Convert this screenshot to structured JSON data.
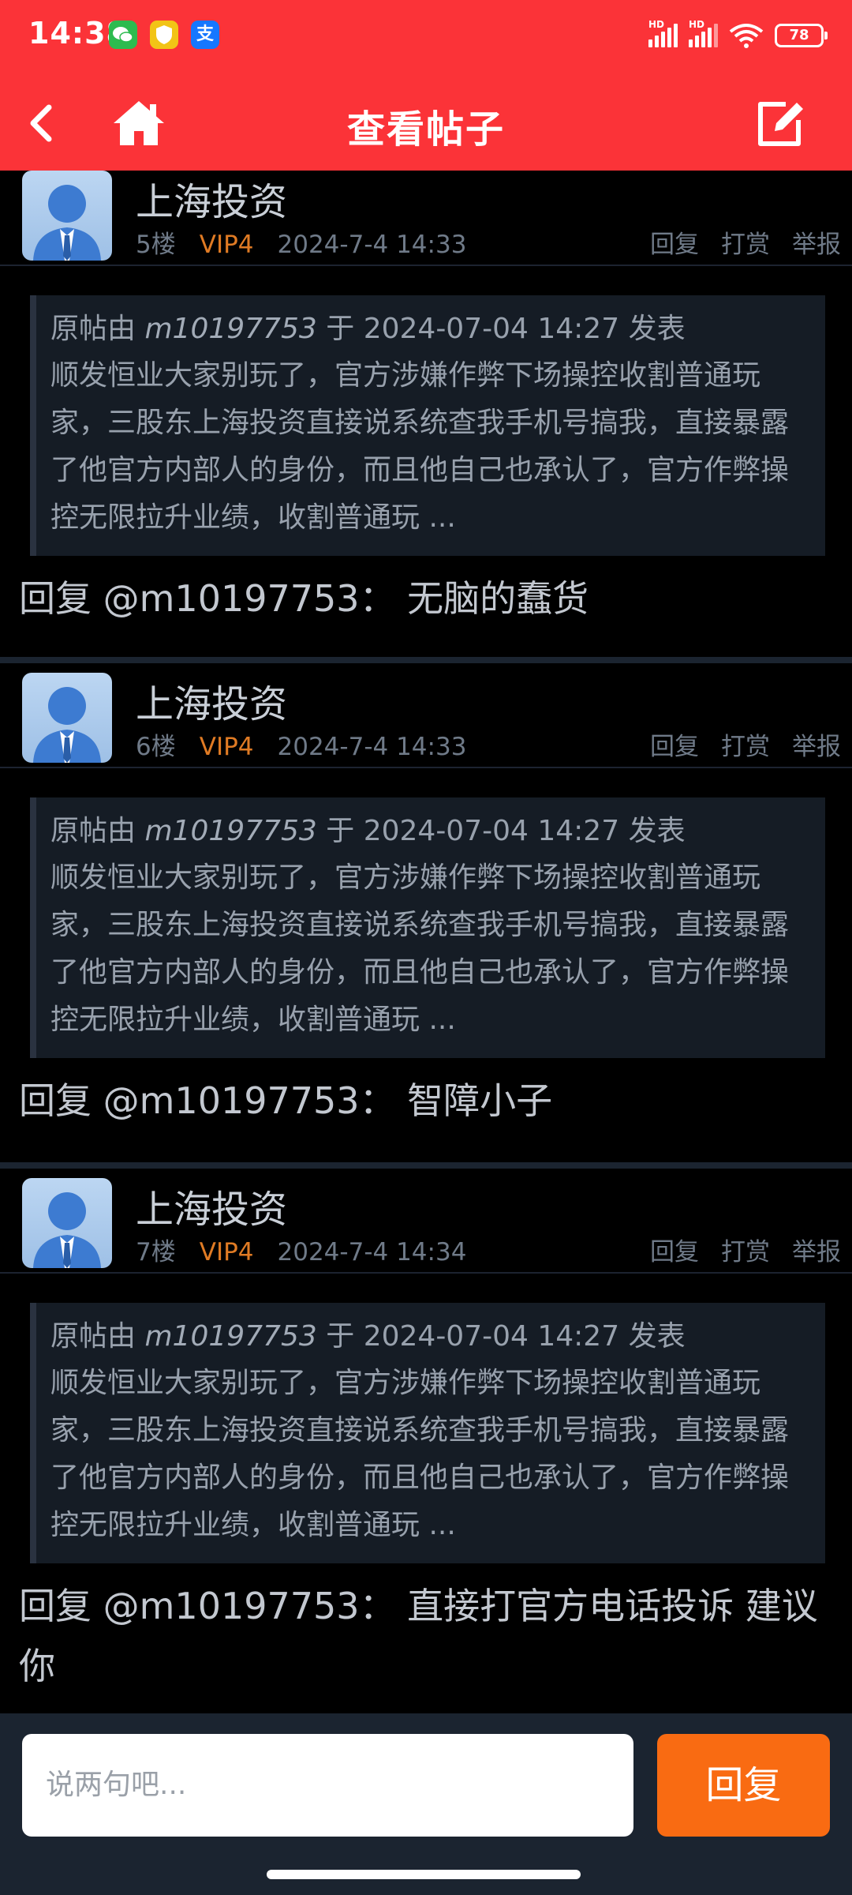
{
  "status_bar": {
    "time": "14:38",
    "battery": "78",
    "network_label": "HD"
  },
  "nav": {
    "title": "查看帖子"
  },
  "posts": [
    {
      "username": "上海投资",
      "floor": "5楼",
      "vip": "VIP4",
      "time": "2024-7-4 14:33",
      "actions": [
        "回复",
        "打赏",
        "举报"
      ],
      "quote_prefix": "原帖由",
      "quote_user": "m10197753",
      "quote_mid": "于",
      "quote_time": "2024-07-04 14:27",
      "quote_suffix": "发表",
      "quote_text": "顺发恒业大家别玩了，官方涉嫌作弊下场操控收割普通玩家，三股东上海投资直接说系统查我手机号搞我，直接暴露了他官方内部人的身份，而且他自己也承认了，官方作弊操控无限拉升业绩，收割普通玩 ...",
      "reply": "回复 @m10197753： 无脑的蠢货"
    },
    {
      "username": "上海投资",
      "floor": "6楼",
      "vip": "VIP4",
      "time": "2024-7-4 14:33",
      "actions": [
        "回复",
        "打赏",
        "举报"
      ],
      "quote_prefix": "原帖由",
      "quote_user": "m10197753",
      "quote_mid": "于",
      "quote_time": "2024-07-04 14:27",
      "quote_suffix": "发表",
      "quote_text": "顺发恒业大家别玩了，官方涉嫌作弊下场操控收割普通玩家，三股东上海投资直接说系统查我手机号搞我，直接暴露了他官方内部人的身份，而且他自己也承认了，官方作弊操控无限拉升业绩，收割普通玩 ...",
      "reply": "回复 @m10197753： 智障小子"
    },
    {
      "username": "上海投资",
      "floor": "7楼",
      "vip": "VIP4",
      "time": "2024-7-4 14:34",
      "actions": [
        "回复",
        "打赏",
        "举报"
      ],
      "quote_prefix": "原帖由",
      "quote_user": "m10197753",
      "quote_mid": "于",
      "quote_time": "2024-07-04 14:27",
      "quote_suffix": "发表",
      "quote_text": "顺发恒业大家别玩了，官方涉嫌作弊下场操控收割普通玩家，三股东上海投资直接说系统查我手机号搞我，直接暴露了他官方内部人的身份，而且他自己也承认了，官方作弊操控无限拉升业绩，收割普通玩 ...",
      "reply": "回复 @m10197753： 直接打官方电话投诉 建议你"
    }
  ],
  "composer": {
    "placeholder": "说两句吧...",
    "submit_label": "回复"
  },
  "icons": {
    "back": "chevron-left-icon",
    "home": "home-icon",
    "edit": "edit-icon",
    "wechat": "wechat-icon",
    "shield": "shield-app-icon",
    "alipay": "alipay-icon"
  },
  "colors": {
    "header_bg": "#fb3338",
    "accent_orange": "#f96b12",
    "vip": "#e07b24",
    "bg": "#000000",
    "quote_bg": "#151c25"
  }
}
